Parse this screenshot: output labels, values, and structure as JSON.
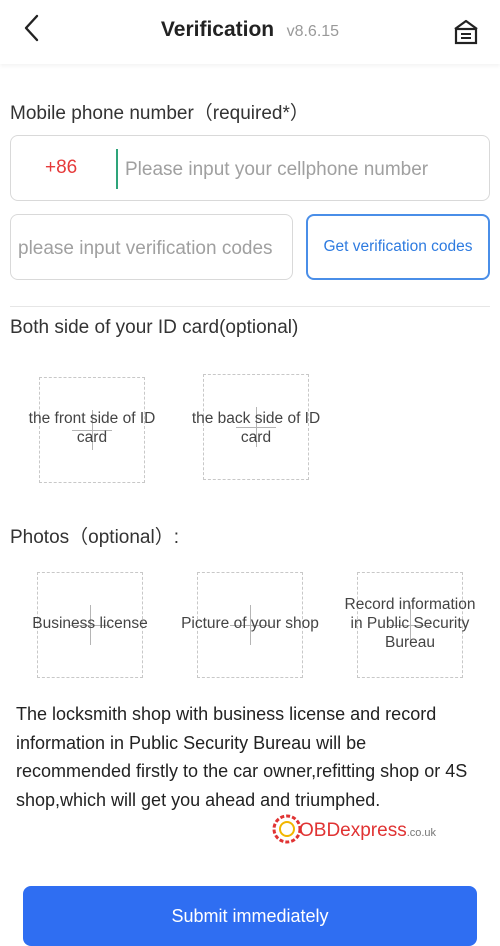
{
  "header": {
    "title": "Verification",
    "version": "v8.6.15",
    "back_icon": "chevron-left-icon",
    "home_icon": "home-icon"
  },
  "phone": {
    "label": "Mobile phone number（required*）",
    "country_code": "+86",
    "placeholder": "Please input your cellphone number",
    "value": ""
  },
  "verification": {
    "placeholder": "please input verification codes",
    "value": "",
    "button_label": "Get verification codes"
  },
  "id_card": {
    "label": "Both side of your ID card(optional)",
    "front_label": "the front side of ID card",
    "back_label": "the back side of ID card"
  },
  "photos": {
    "label": "Photos（optional）:",
    "items": [
      {
        "label": "Business license"
      },
      {
        "label": "Picture of your shop"
      },
      {
        "label": "Record information in Public Security Bureau"
      }
    ]
  },
  "notice": "The locksmith shop with business license and record information in Public Security Bureau will be recommended firstly to the car owner,refitting shop or 4S shop,which will get you ahead and triumphed.",
  "watermark": {
    "brand": "OBDexpress",
    "suffix": ".co.uk"
  },
  "submit_label": "Submit immediately",
  "colors": {
    "accent": "#2f6ef2",
    "country_code": "#e63b3b",
    "link_blue": "#2e7be0",
    "border": "#d9d9d9"
  }
}
